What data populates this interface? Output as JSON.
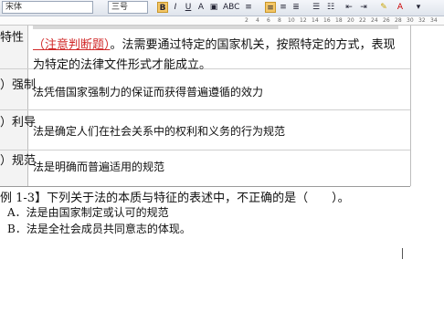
{
  "toolbar": {
    "font_name": "宋体",
    "font_size": "三号",
    "bold": "B",
    "italic": "I",
    "underline": "U",
    "font_color": "A",
    "extra": "ABC",
    "ruler_labels": [
      "2",
      "4",
      "6",
      "8",
      "10",
      "12",
      "14",
      "16",
      "18",
      "20",
      "22",
      "24",
      "26",
      "28",
      "30",
      "32",
      "34"
    ]
  },
  "document": {
    "left_labels": [
      "特性",
      "）强制",
      "）利导",
      "）规范"
    ],
    "row1_line1": "（注意判断题）。法需要通过特定的国家机关，按照特定的方式，表现",
    "row1_emphasis": "（注意判断题）",
    "row1_rest": "。法需要通过特定的国家机关，按照特定的方式，表现",
    "row1_line2": "为特定的法律文件形式才能成立。",
    "row2": "法凭借国家强制力的保证而获得普遍遵循的效力",
    "row3": "法是确定人们在社会关系中的权利和义务的行为规范",
    "row4": "法是明确而普遍适用的规范",
    "question": "例 1-3】下列关于法的本质与特征的表述中，不正确的是（　　）。",
    "option_a": "A．法是由国家制定或认可的规范",
    "option_b": "B．法是全社会成员共同意志的体现。"
  }
}
